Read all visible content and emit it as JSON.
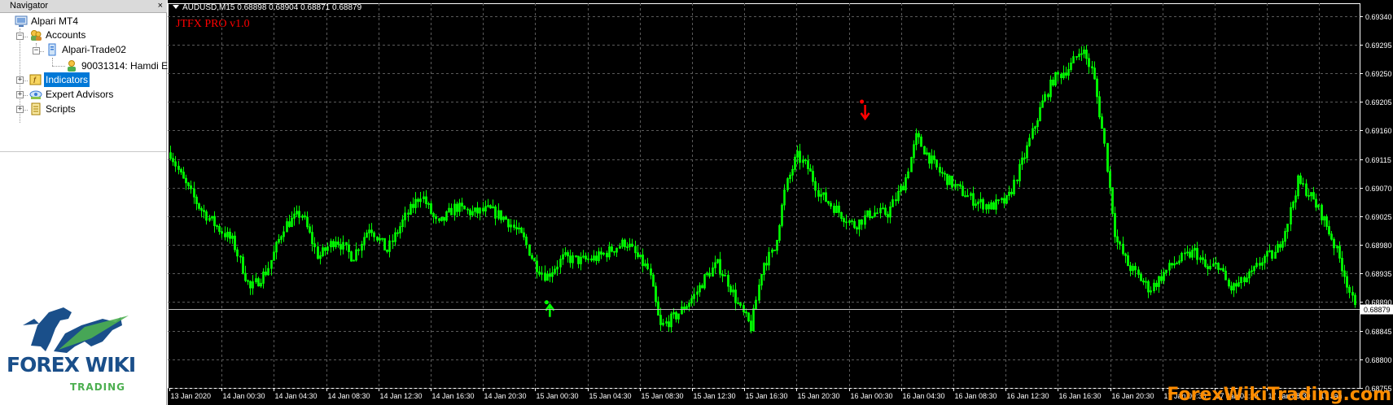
{
  "navigator": {
    "title": "Navigator",
    "close_label": "×",
    "tree": {
      "root": "Alpari MT4",
      "accounts": "Accounts",
      "server": "Alpari-Trade02",
      "account": "90031314: Hamdi E",
      "indicators": "Indicators",
      "experts": "Expert Advisors",
      "scripts": "Scripts"
    }
  },
  "logo": {
    "word": "FOREX WIKI",
    "sub": "TRADING"
  },
  "chart": {
    "symbol_header": "AUDUSD,M15  0.68898 0.68904 0.68871 0.68879",
    "indicator_name": "JTFX PRO v1.0",
    "watermark": "ForexWikiTrading.com",
    "colors": {
      "background": "#000000",
      "candles": "#00ff00",
      "grid": "#5a5a5a",
      "axis_text": "#ffffff",
      "sell_signal": "#ff0000",
      "buy_signal": "#00ff00",
      "current_price_label_bg": "#ffffff"
    },
    "current_price": "0.68879"
  },
  "chart_data": {
    "type": "candlestick",
    "symbol": "AUDUSD",
    "timeframe": "M15",
    "ohlc_last": {
      "open": 0.68898,
      "high": 0.68904,
      "low": 0.68871,
      "close": 0.68879
    },
    "price_ticks": [
      "0.69340",
      "0.69295",
      "0.69250",
      "0.69205",
      "0.69160",
      "0.69115",
      "0.69070",
      "0.69025",
      "0.68980",
      "0.68935",
      "0.68890",
      "0.68845",
      "0.68800",
      "0.68755"
    ],
    "time_ticks": [
      "13 Jan 2020",
      "14 Jan 00:30",
      "14 Jan 04:30",
      "14 Jan 08:30",
      "14 Jan 12:30",
      "14 Jan 16:30",
      "14 Jan 20:30",
      "15 Jan 00:30",
      "15 Jan 04:30",
      "15 Jan 08:30",
      "15 Jan 12:30",
      "15 Jan 16:30",
      "15 Jan 20:30",
      "16 Jan 00:30",
      "16 Jan 04:30",
      "16 Jan 08:30",
      "16 Jan 12:30",
      "16 Jan 16:30",
      "16 Jan 20:30",
      "17 Jan 00:30",
      "17 Jan 04:30",
      "17 Jan 08:30",
      "17 Jan"
    ],
    "ylim": [
      0.68755,
      0.6936
    ],
    "grid": true,
    "price_path": [
      [
        0,
        0.69125
      ],
      [
        0.01,
        0.69085
      ],
      [
        0.025,
        0.6904
      ],
      [
        0.04,
        0.6901
      ],
      [
        0.055,
        0.68985
      ],
      [
        0.07,
        0.6891
      ],
      [
        0.085,
        0.6894
      ],
      [
        0.1,
        0.6901
      ],
      [
        0.115,
        0.6903
      ],
      [
        0.13,
        0.6896
      ],
      [
        0.145,
        0.6899
      ],
      [
        0.16,
        0.6896
      ],
      [
        0.175,
        0.6901
      ],
      [
        0.19,
        0.6897
      ],
      [
        0.205,
        0.6902
      ],
      [
        0.22,
        0.6906
      ],
      [
        0.235,
        0.6901
      ],
      [
        0.25,
        0.6904
      ],
      [
        0.265,
        0.6903
      ],
      [
        0.28,
        0.69035
      ],
      [
        0.295,
        0.6902
      ],
      [
        0.31,
        0.6899
      ],
      [
        0.32,
        0.6895
      ],
      [
        0.33,
        0.6893
      ],
      [
        0.345,
        0.6896
      ],
      [
        0.36,
        0.68955
      ],
      [
        0.375,
        0.6896
      ],
      [
        0.39,
        0.68975
      ],
      [
        0.4,
        0.68985
      ],
      [
        0.41,
        0.6896
      ],
      [
        0.42,
        0.6894
      ],
      [
        0.43,
        0.6885
      ],
      [
        0.445,
        0.6887
      ],
      [
        0.46,
        0.689
      ],
      [
        0.47,
        0.6893
      ],
      [
        0.48,
        0.6895
      ],
      [
        0.49,
        0.6892
      ],
      [
        0.5,
        0.6888
      ],
      [
        0.51,
        0.6885
      ],
      [
        0.52,
        0.6895
      ],
      [
        0.53,
        0.6897
      ],
      [
        0.54,
        0.6907
      ],
      [
        0.55,
        0.6912
      ],
      [
        0.56,
        0.691
      ],
      [
        0.57,
        0.6906
      ],
      [
        0.585,
        0.69035
      ],
      [
        0.6,
        0.6901
      ],
      [
        0.615,
        0.6903
      ],
      [
        0.63,
        0.6903
      ],
      [
        0.645,
        0.6908
      ],
      [
        0.655,
        0.6915
      ],
      [
        0.665,
        0.6912
      ],
      [
        0.675,
        0.69095
      ],
      [
        0.69,
        0.6907
      ],
      [
        0.705,
        0.6905
      ],
      [
        0.72,
        0.6904
      ],
      [
        0.735,
        0.6905
      ],
      [
        0.75,
        0.6912
      ],
      [
        0.765,
        0.692
      ],
      [
        0.775,
        0.6924
      ],
      [
        0.79,
        0.6926
      ],
      [
        0.8,
        0.6929
      ],
      [
        0.81,
        0.6925
      ],
      [
        0.82,
        0.6914
      ],
      [
        0.83,
        0.6899
      ],
      [
        0.84,
        0.6895
      ],
      [
        0.85,
        0.6893
      ],
      [
        0.86,
        0.6891
      ],
      [
        0.87,
        0.6893
      ],
      [
        0.88,
        0.6895
      ],
      [
        0.89,
        0.6896
      ],
      [
        0.9,
        0.6897
      ],
      [
        0.91,
        0.6894
      ],
      [
        0.92,
        0.6895
      ],
      [
        0.93,
        0.6891
      ],
      [
        0.94,
        0.6892
      ],
      [
        0.95,
        0.68935
      ],
      [
        0.96,
        0.6896
      ],
      [
        0.97,
        0.68965
      ],
      [
        0.98,
        0.6901
      ],
      [
        0.99,
        0.6908
      ],
      [
        1.0,
        0.6906
      ],
      [
        1.01,
        0.6903
      ],
      [
        1.02,
        0.6899
      ],
      [
        1.03,
        0.6894
      ],
      [
        1.04,
        0.68879
      ]
    ],
    "signals": [
      {
        "type": "buy",
        "time": "15 Jan 00:30",
        "price": 0.68905
      },
      {
        "type": "sell",
        "time": "16 Jan 00:30",
        "price": 0.69195
      }
    ]
  }
}
